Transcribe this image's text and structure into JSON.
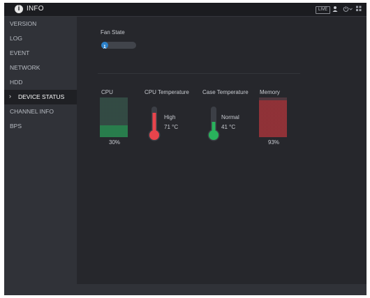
{
  "header": {
    "title": "INFO",
    "live_label": "LIVE"
  },
  "sidebar": {
    "items": [
      {
        "label": "VERSION"
      },
      {
        "label": "LOG"
      },
      {
        "label": "EVENT"
      },
      {
        "label": "NETWORK"
      },
      {
        "label": "HDD"
      },
      {
        "label": "DEVICE STATUS",
        "active": true
      },
      {
        "label": "CHANNEL INFO"
      },
      {
        "label": "BPS"
      }
    ]
  },
  "fan": {
    "title": "Fan State",
    "icon": "fan-icon"
  },
  "status": {
    "cpu": {
      "label": "CPU",
      "value": "30%",
      "fraction": 0.3
    },
    "cpu_temp": {
      "label": "CPU Temperature",
      "state": "High",
      "value": "71 °C",
      "fraction": 0.8
    },
    "case_temp": {
      "label": "Case Temperature",
      "state": "Normal",
      "value": "41 °C",
      "fraction": 0.45
    },
    "memory": {
      "label": "Memory",
      "value": "93%",
      "fraction": 0.93
    }
  },
  "colors": {
    "cpu_fill": "#2fb866",
    "memory_fill": "#d63d44",
    "hot_thermo": "#e8444c",
    "normal_thermo": "#29b25c",
    "fan_blue": "#2b80c9"
  }
}
